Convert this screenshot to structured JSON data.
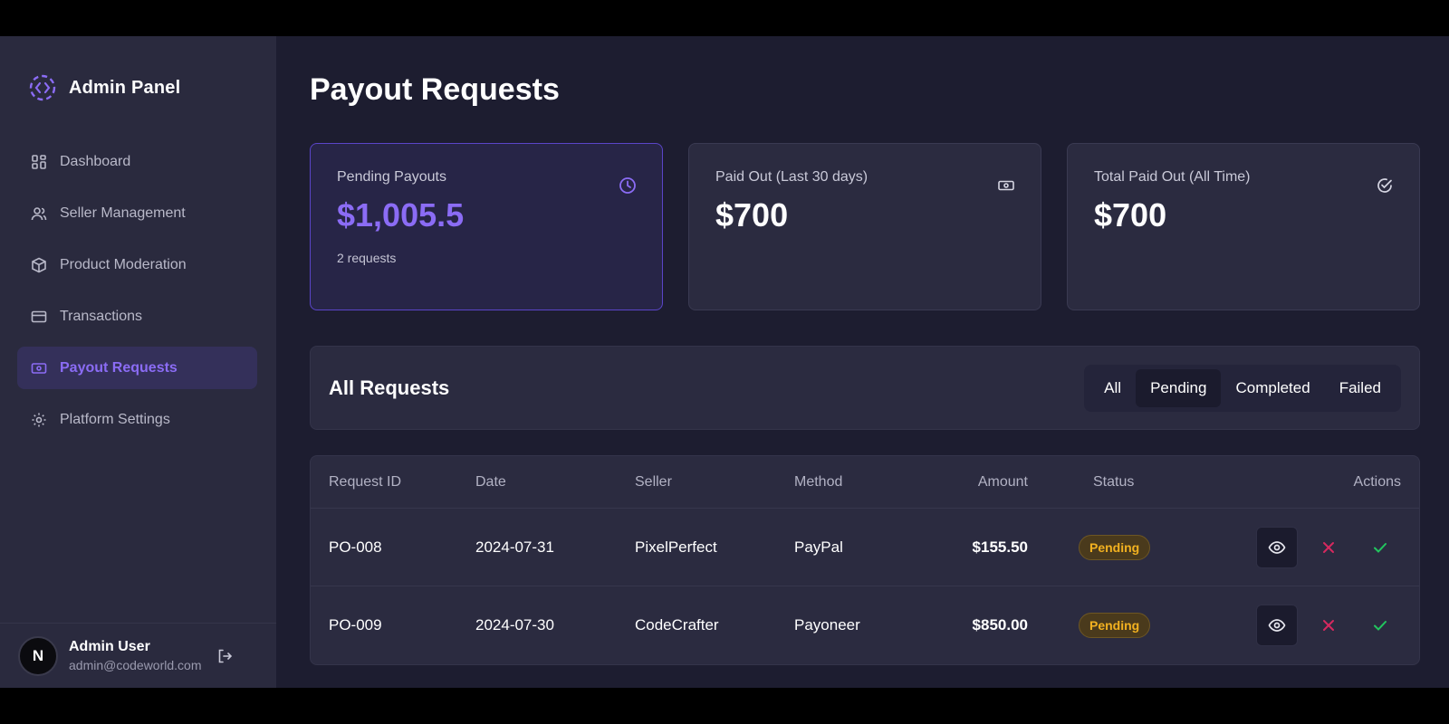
{
  "sidebar": {
    "brand": "Admin Panel",
    "items": [
      {
        "label": "Dashboard",
        "icon": "grid-icon"
      },
      {
        "label": "Seller Management",
        "icon": "users-icon"
      },
      {
        "label": "Product Moderation",
        "icon": "box-icon"
      },
      {
        "label": "Transactions",
        "icon": "credit-card-icon"
      },
      {
        "label": "Payout Requests",
        "icon": "banknote-icon",
        "active": true
      },
      {
        "label": "Platform Settings",
        "icon": "gear-icon"
      }
    ],
    "user": {
      "initial": "N",
      "name": "Admin User",
      "email": "admin@codeworld.com"
    }
  },
  "main": {
    "title": "Payout Requests",
    "cards": [
      {
        "label": "Pending Payouts",
        "value": "$1,005.5",
        "sub": "2 requests",
        "icon": "clock-icon"
      },
      {
        "label": "Paid Out (Last 30 days)",
        "value": "$700",
        "icon": "banknote-icon"
      },
      {
        "label": "Total Paid Out (All Time)",
        "value": "$700",
        "icon": "check-circle-icon"
      }
    ],
    "requests": {
      "title": "All Requests",
      "filters": [
        "All",
        "Pending",
        "Completed",
        "Failed"
      ],
      "active_filter": "Pending"
    },
    "table": {
      "headers": {
        "id": "Request ID",
        "date": "Date",
        "seller": "Seller",
        "method": "Method",
        "amount": "Amount",
        "status": "Status",
        "actions": "Actions"
      },
      "rows": [
        {
          "id": "PO-008",
          "date": "2024-07-31",
          "seller": "PixelPerfect",
          "method": "PayPal",
          "amount": "$155.50",
          "status": "Pending"
        },
        {
          "id": "PO-009",
          "date": "2024-07-30",
          "seller": "CodeCrafter",
          "method": "Payoneer",
          "amount": "$850.00",
          "status": "Pending"
        }
      ]
    }
  },
  "colors": {
    "accent": "#8b6cf5",
    "background": "#1d1d30",
    "sidebar": "#2a2a3e",
    "pending_badge": "#f2b120",
    "reject": "#d6295f",
    "approve": "#22c55e"
  }
}
